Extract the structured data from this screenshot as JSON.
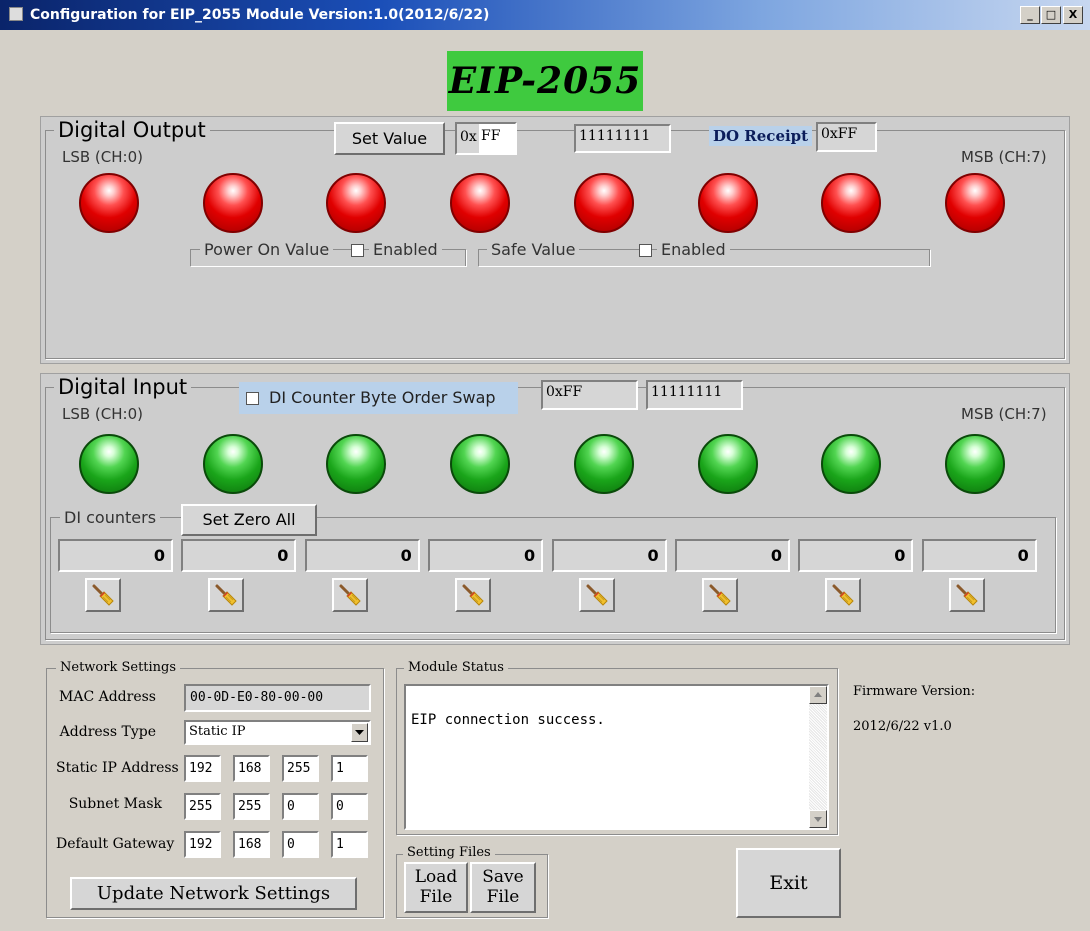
{
  "window": {
    "title": "Configuration for EIP_2055 Module Version:1.0(2012/6/22)",
    "min": "_",
    "max": "□",
    "close": "X"
  },
  "banner": {
    "text": "EIP-2055",
    "color": "#3fca3f"
  },
  "digital_output": {
    "title": "Digital Output",
    "set_value_button": "Set Value",
    "hex_prefix": "0x",
    "hex_value": "FF",
    "binary_value": "11111111",
    "do_receipt_label": "DO Receipt",
    "do_receipt_value": "0xFF",
    "lsb_label": "LSB (CH:0)",
    "msb_label": "MSB (CH:7)",
    "leds": [
      "on",
      "on",
      "on",
      "on",
      "on",
      "on",
      "on",
      "on"
    ],
    "led_color": "#e00000",
    "power_on_value_label": "Power On Value",
    "power_on_enabled_label": "Enabled",
    "safe_value_label": "Safe Value",
    "safe_enabled_label": "Enabled"
  },
  "digital_input": {
    "title": "Digital Input",
    "swap_checkbox_label": "DI Counter Byte Order Swap",
    "hex_value": "0xFF",
    "binary_value": "11111111",
    "lsb_label": "LSB (CH:0)",
    "msb_label": "MSB (CH:7)",
    "leds": [
      "on",
      "on",
      "on",
      "on",
      "on",
      "on",
      "on",
      "on"
    ],
    "led_color": "#1aa51a",
    "counters_label": "DI counters",
    "set_zero_all_button": "Set Zero All",
    "counters": [
      "0",
      "0",
      "0",
      "0",
      "0",
      "0",
      "0",
      "0"
    ],
    "clear_icon": "broom-icon"
  },
  "network": {
    "title": "Network Settings",
    "mac_label": "MAC Address",
    "mac_value": "00-0D-E0-80-00-00",
    "address_type_label": "Address Type",
    "address_type_value": "Static IP",
    "static_ip_label": "Static IP Address",
    "static_ip": [
      "192",
      "168",
      "255",
      "1"
    ],
    "subnet_label": "Subnet Mask",
    "subnet": [
      "255",
      "255",
      "0",
      "0"
    ],
    "gateway_label": "Default Gateway",
    "gateway": [
      "192",
      "168",
      "0",
      "1"
    ],
    "update_button": "Update Network Settings"
  },
  "module_status": {
    "title": "Module Status",
    "text": "EIP connection success."
  },
  "firmware": {
    "label": "Firmware Version:",
    "value": "2012/6/22 v1.0"
  },
  "setting_files": {
    "title": "Setting Files",
    "load_line1": "Load",
    "load_line2": "File",
    "save_line1": "Save",
    "save_line2": "File"
  },
  "exit_button": "Exit"
}
